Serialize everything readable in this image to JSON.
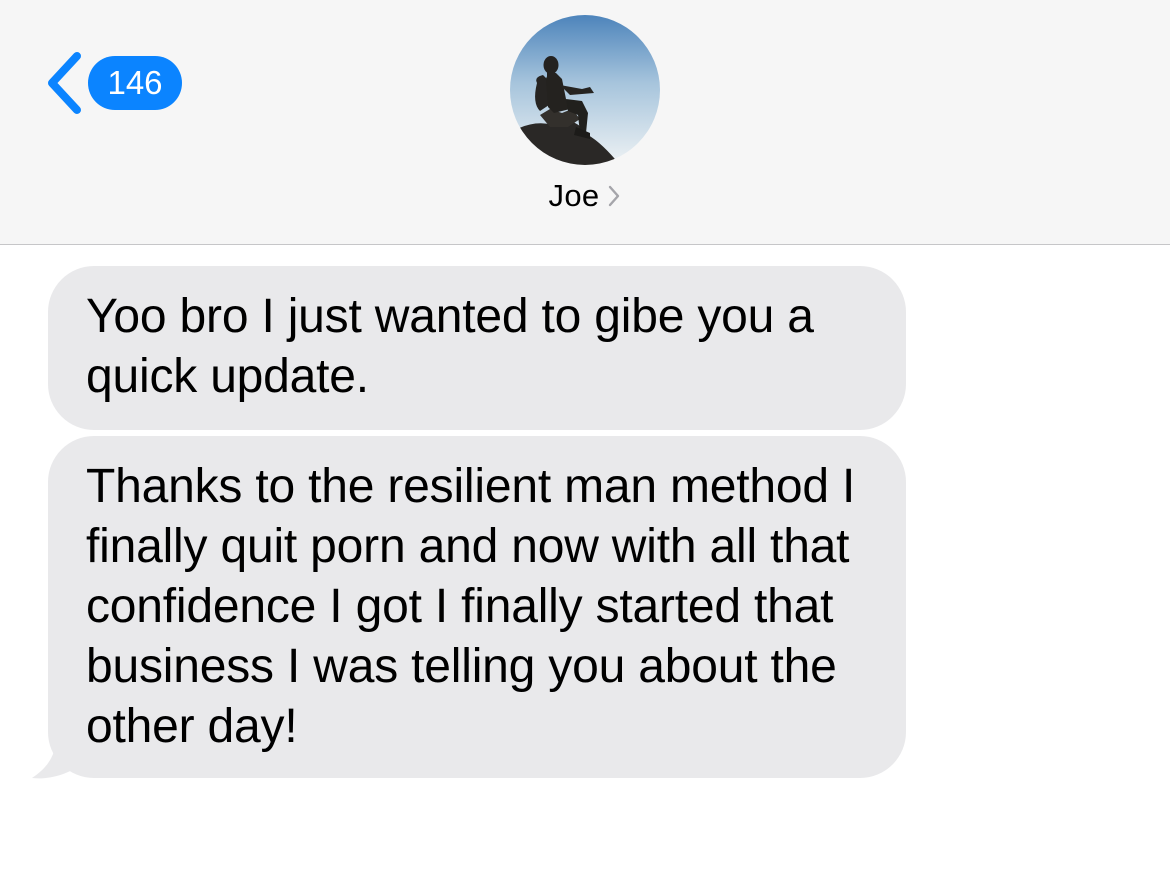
{
  "header": {
    "back_badge_count": "146",
    "contact_name": "Joe"
  },
  "messages": [
    {
      "sender": "incoming",
      "text": "Yoo bro I just wanted to gibe you a quick update."
    },
    {
      "sender": "incoming",
      "text": "Thanks to the resilient man method I finally quit porn and now with all that confidence I got I finally started that business I was telling you about the other day!"
    }
  ],
  "colors": {
    "header_background": "#f6f6f6",
    "accent_blue": "#0b84ff",
    "incoming_bubble": "#e9e9eb",
    "separator": "#c6c6c8"
  },
  "icons": {
    "back": "chevron-left-icon",
    "contact_details": "chevron-right-icon",
    "avatar": "contact-photo-silhouette"
  }
}
